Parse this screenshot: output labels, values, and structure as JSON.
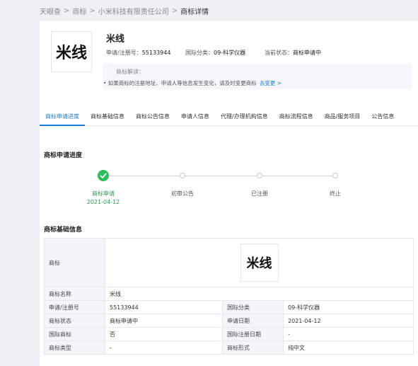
{
  "breadcrumb": {
    "items": [
      "天眼查",
      "商标",
      "小米科技有限责任公司",
      "商标详情"
    ],
    "sep": ">"
  },
  "header": {
    "logo_text": "米线",
    "title": "米线",
    "reg_no_label": "申请/注册号：",
    "reg_no": "55133944",
    "class_label": "国际分类：",
    "class_value": "09-科学仪器",
    "status_label": "当前状态：",
    "status_value": "商标申请中"
  },
  "interpret": {
    "title": "商标解读：",
    "text": "• 如果商标的注册地址、申请人等信息发生变化，请及时变更商标",
    "link": "去变更 >"
  },
  "tabs": [
    "商标申请进度",
    "商标基础信息",
    "商标公告信息",
    "申请人信息",
    "代理/办理机构信息",
    "商标流程信息",
    "商品/服务项目",
    "公告信息"
  ],
  "progress": {
    "title": "商标申请进度",
    "steps": [
      {
        "label": "商标申请",
        "date": "2021-04-12"
      },
      {
        "label": "初审公告"
      },
      {
        "label": "已注册"
      },
      {
        "label": "终止"
      }
    ],
    "completed_steps": 1
  },
  "basic": {
    "title": "商标基础信息",
    "image_label": "商标",
    "image_text": "米线",
    "name_label": "商标名称",
    "name_value": "米线",
    "rows": [
      [
        "申请/注册号",
        "55133944",
        "国际分类",
        "09-科学仪器"
      ],
      [
        "商标状态",
        "商标申请中",
        "申请日期",
        "2021-04-12"
      ],
      [
        "国际商标",
        "否",
        "国际注册日期",
        "-"
      ],
      [
        "商标类型",
        "-",
        "商标形式",
        "纯中文"
      ]
    ]
  },
  "colors": {
    "accent": "#1a7cdc",
    "success": "#2bbf5b"
  }
}
